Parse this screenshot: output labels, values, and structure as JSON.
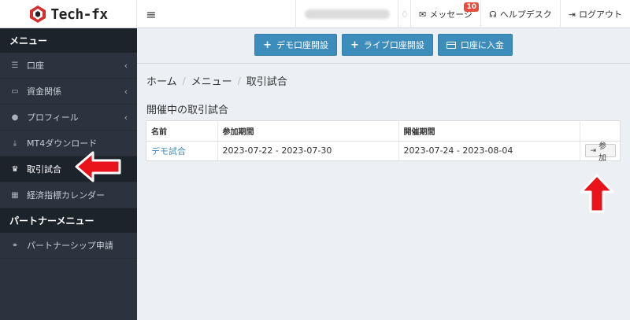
{
  "header": {
    "logo_text": "Tech-fx",
    "menu_icon": "hamburger-icon",
    "nav": {
      "messages_label": "メッセージ",
      "messages_badge": "10",
      "helpdesk_label": "ヘルプデスク",
      "logout_label": "ログアウト"
    }
  },
  "sidebar": {
    "menu_header": "メニュー",
    "items": [
      {
        "label": "口座",
        "icon": "list-icon"
      },
      {
        "label": "資金関係",
        "icon": "wallet-icon"
      },
      {
        "label": "プロフィール",
        "icon": "user-icon"
      },
      {
        "label": "MT4ダウンロード",
        "icon": "download-icon"
      },
      {
        "label": "取引試合",
        "icon": "trophy-icon"
      },
      {
        "label": "経済指標カレンダー",
        "icon": "calendar-icon"
      }
    ],
    "partner_header": "パートナーメニュー",
    "partner_items": [
      {
        "label": "パートナーシップ申請",
        "icon": "handshake-icon"
      }
    ]
  },
  "actions": {
    "demo_account": "デモ口座開設",
    "live_account": "ライブ口座開設",
    "deposit": "口座に入金"
  },
  "breadcrumb": [
    "ホーム",
    "メニュー",
    "取引試合"
  ],
  "section_title": "開催中の取引試合",
  "table": {
    "headers": [
      "名前",
      "参加期間",
      "開催期間",
      ""
    ],
    "rows": [
      {
        "name": "デモ試合",
        "participation": "2023-07-22 - 2023-07-30",
        "event": "2023-07-24 - 2023-08-04",
        "action": "参加"
      }
    ]
  },
  "colors": {
    "primary": "#3c8dbc",
    "sidebar_bg": "#2b333e",
    "sidebar_header_bg": "#1d232b",
    "badge": "#e74c3c",
    "annotation_arrow": "#e8131b"
  }
}
